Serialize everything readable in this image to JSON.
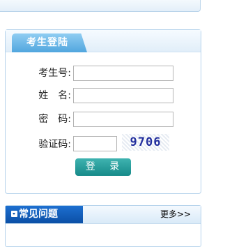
{
  "login": {
    "tab_label": "考生登陆",
    "fields": [
      {
        "label": "考生号:",
        "value": ""
      },
      {
        "label": "姓　名:",
        "value": ""
      },
      {
        "label": "密　码:",
        "value": ""
      },
      {
        "label": "验证码:",
        "value": ""
      }
    ],
    "captcha_text": "9706",
    "submit_label": "登 录"
  },
  "faq": {
    "title": "常见问题",
    "more_label": "更多>>"
  }
}
